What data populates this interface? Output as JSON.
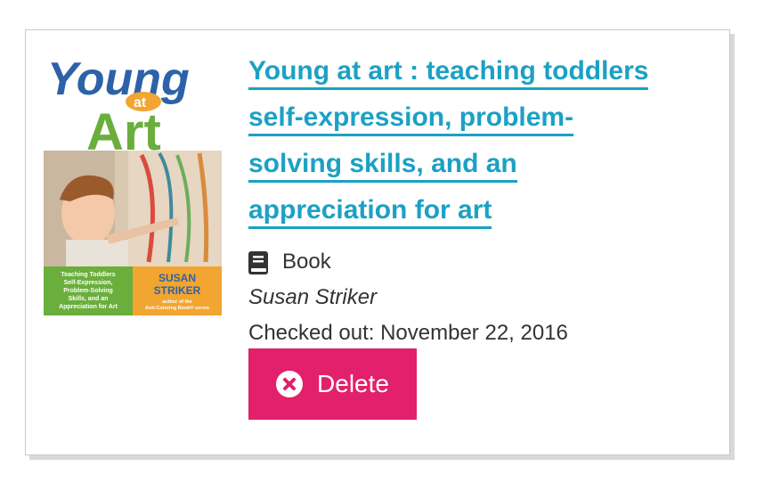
{
  "item": {
    "title": "Young at art : teaching toddlers self-expression, problem-solving skills, and an appreciation for art",
    "title_lines": [
      "Young at art : teaching toddlers",
      "self-expression, problem-",
      "solving skills, and an",
      "appreciation for art"
    ],
    "format": "Book",
    "format_icon": "book-icon",
    "author": "Susan Striker",
    "checked_out": "Checked out: November 22, 2016"
  },
  "cover": {
    "title_word1": "Young",
    "title_word2": "at",
    "title_word3": "Art",
    "subtitle_lines": [
      "Teaching Toddlers",
      "Self-Expression,",
      "Problem-Solving",
      "Skills, and an",
      "Appreciation for Art"
    ],
    "author_line1": "SUSAN",
    "author_line2": "STRIKER",
    "author_note_lines": [
      "author of the",
      "Anti-Coloring Book® series"
    ]
  },
  "actions": {
    "delete_label": "Delete",
    "delete_icon": "close-circle-icon"
  },
  "colors": {
    "link": "#1ba1c4",
    "delete": "#e3206b"
  }
}
